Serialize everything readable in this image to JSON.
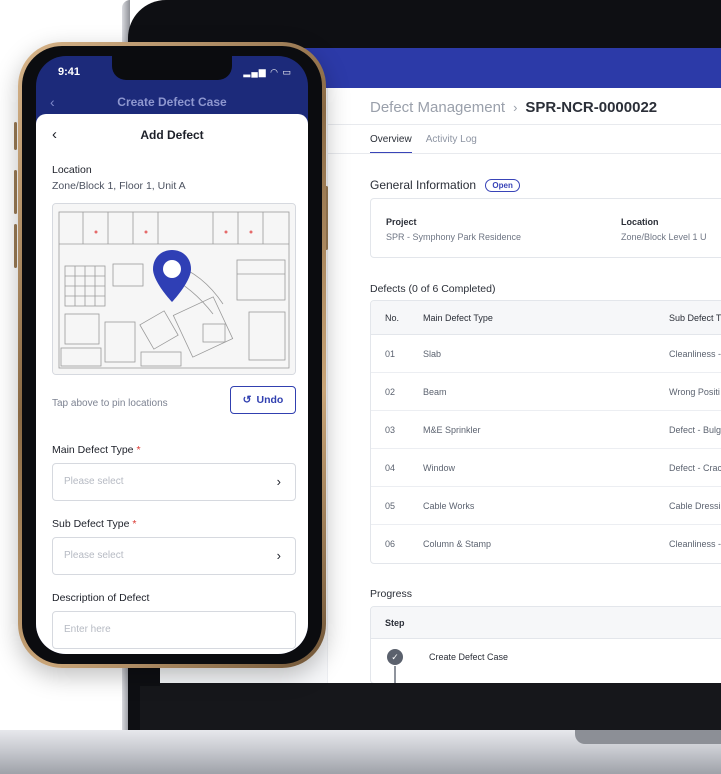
{
  "laptop": {
    "breadcrumb": {
      "parent": "Defect Management",
      "separator": "›",
      "current": "SPR-NCR-0000022"
    },
    "tabs": [
      {
        "label": "Overview",
        "active": true
      },
      {
        "label": "Activity Log",
        "active": false
      }
    ],
    "general_information": {
      "title": "General Information",
      "status_badge": "Open",
      "project_label": "Project",
      "project_value": "SPR - Symphony Park Residence",
      "location_label": "Location",
      "location_value": "Zone/Block Level 1 U"
    },
    "defects": {
      "title": "Defects (0 of 6 Completed)",
      "columns": [
        "No.",
        "Main Defect Type",
        "Sub Defect T"
      ],
      "rows": [
        {
          "no": "01",
          "main": "Slab",
          "sub": "Cleanliness -"
        },
        {
          "no": "02",
          "main": "Beam",
          "sub": "Wrong Positi"
        },
        {
          "no": "03",
          "main": "M&E Sprinkler",
          "sub": "Defect - Bulg"
        },
        {
          "no": "04",
          "main": "Window",
          "sub": "Defect - Crac"
        },
        {
          "no": "05",
          "main": "Cable Works",
          "sub": "Cable Dressi"
        },
        {
          "no": "06",
          "main": "Column & Stamp",
          "sub": "Cleanliness -"
        }
      ]
    },
    "progress": {
      "title": "Progress",
      "column": "Step",
      "steps": [
        {
          "label": "Create Defect Case",
          "done": true
        }
      ]
    },
    "colors": {
      "topbar": "#2c3aa8",
      "accent": "#3944b8"
    }
  },
  "phone": {
    "status_time": "9:41",
    "status_icons": "▂▄▆ ◠ ▭",
    "back_header_title": "Create Defect Case",
    "sheet_title": "Add Defect",
    "location_label": "Location",
    "location_value": "Zone/Block 1, Floor 1, Unit A",
    "map_hint": "Tap above to pin locations",
    "undo_label": "Undo",
    "main_defect_label": "Main Defect Type",
    "main_defect_placeholder": "Please select",
    "sub_defect_label": "Sub Defect Type",
    "sub_defect_placeholder": "Please select",
    "required_mark": "*",
    "description_label": "Description of Defect",
    "description_placeholder": "Enter here",
    "colors": {
      "header": "#1c2a7a",
      "pin": "#2f3fb5",
      "required": "#d9352e"
    }
  }
}
